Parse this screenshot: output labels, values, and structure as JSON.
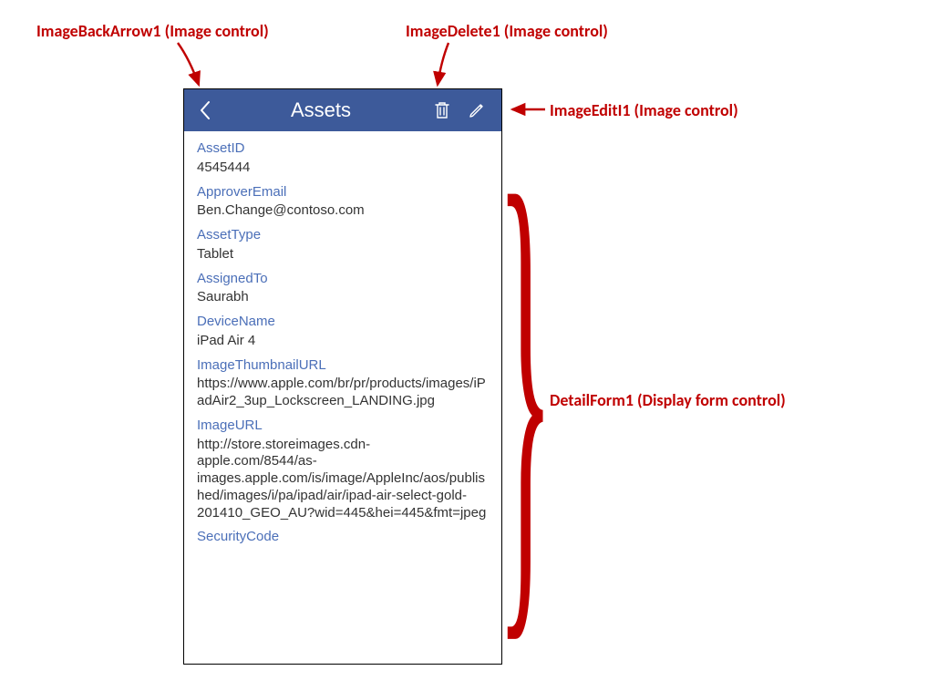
{
  "callouts": {
    "backArrow": "ImageBackArrow1 (Image control)",
    "delete": "ImageDelete1 (Image control)",
    "edit": "ImageEditI1 (Image control)",
    "detailForm": "DetailForm1 (Display form control)"
  },
  "header": {
    "title": "Assets"
  },
  "fields": [
    {
      "label": "AssetID",
      "value": "4545444"
    },
    {
      "label": "ApproverEmail",
      "value": "Ben.Change@contoso.com"
    },
    {
      "label": "AssetType",
      "value": "Tablet"
    },
    {
      "label": "AssignedTo",
      "value": "Saurabh"
    },
    {
      "label": "DeviceName",
      "value": "iPad Air 4"
    },
    {
      "label": "ImageThumbnailURL",
      "value": "https://www.apple.com/br/pr/products/images/iPadAir2_3up_Lockscreen_LANDING.jpg"
    },
    {
      "label": "ImageURL",
      "value": "http://store.storeimages.cdn-apple.com/8544/as-images.apple.com/is/image/AppleInc/aos/published/images/i/pa/ipad/air/ipad-air-select-gold-201410_GEO_AU?wid=445&hei=445&fmt=jpeg"
    },
    {
      "label": "SecurityCode",
      "value": ""
    }
  ],
  "colors": {
    "callout": "#C00000",
    "headerBg": "#3D5A9A",
    "fieldLabel": "#4B6FB8"
  }
}
